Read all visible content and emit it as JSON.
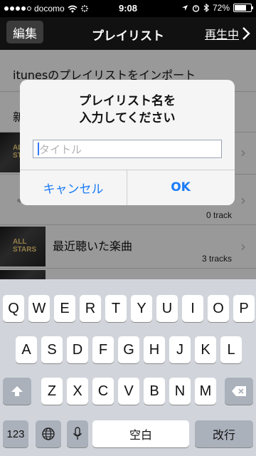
{
  "status_bar": {
    "carrier": "docomo",
    "time": "9:08",
    "battery_percent": "72%",
    "battery_level": 0.72,
    "icons": [
      "signal-dots-icon",
      "wifi-icon",
      "activity-spinner-icon",
      "location-arrow-icon",
      "alarm-icon",
      "bluetooth-icon",
      "battery-icon"
    ]
  },
  "nav": {
    "edit_label": "編集",
    "title": "プレイリスト",
    "now_playing_label": "再生中"
  },
  "list": {
    "items": [
      {
        "title": "itunesのプレイリストをインポート",
        "count": ""
      },
      {
        "title": "新",
        "count": ""
      },
      {
        "title": "",
        "count": ""
      },
      {
        "title": "",
        "count": "0 track"
      },
      {
        "title": "最近聴いた楽曲",
        "count": "3 tracks"
      }
    ],
    "thumb_text": "ALL STARS"
  },
  "alert": {
    "message_line1": "プレイリスト名を",
    "message_line2": "入力してください",
    "placeholder": "タイトル",
    "cancel_label": "キャンセル",
    "ok_label": "OK"
  },
  "keyboard": {
    "row1": [
      "Q",
      "W",
      "E",
      "R",
      "T",
      "Y",
      "U",
      "I",
      "O",
      "P"
    ],
    "row2": [
      "A",
      "S",
      "D",
      "F",
      "G",
      "H",
      "J",
      "K",
      "L"
    ],
    "row3": [
      "Z",
      "X",
      "C",
      "V",
      "B",
      "N",
      "M"
    ],
    "numbers_label": "123",
    "space_label": "空白",
    "return_label": "改行",
    "icons": [
      "shift-icon",
      "backspace-icon",
      "globe-icon",
      "microphone-icon"
    ]
  },
  "colors": {
    "accent": "#1a7cf6",
    "nav_background": "#111111",
    "keyboard_background": "#d1d5db"
  }
}
